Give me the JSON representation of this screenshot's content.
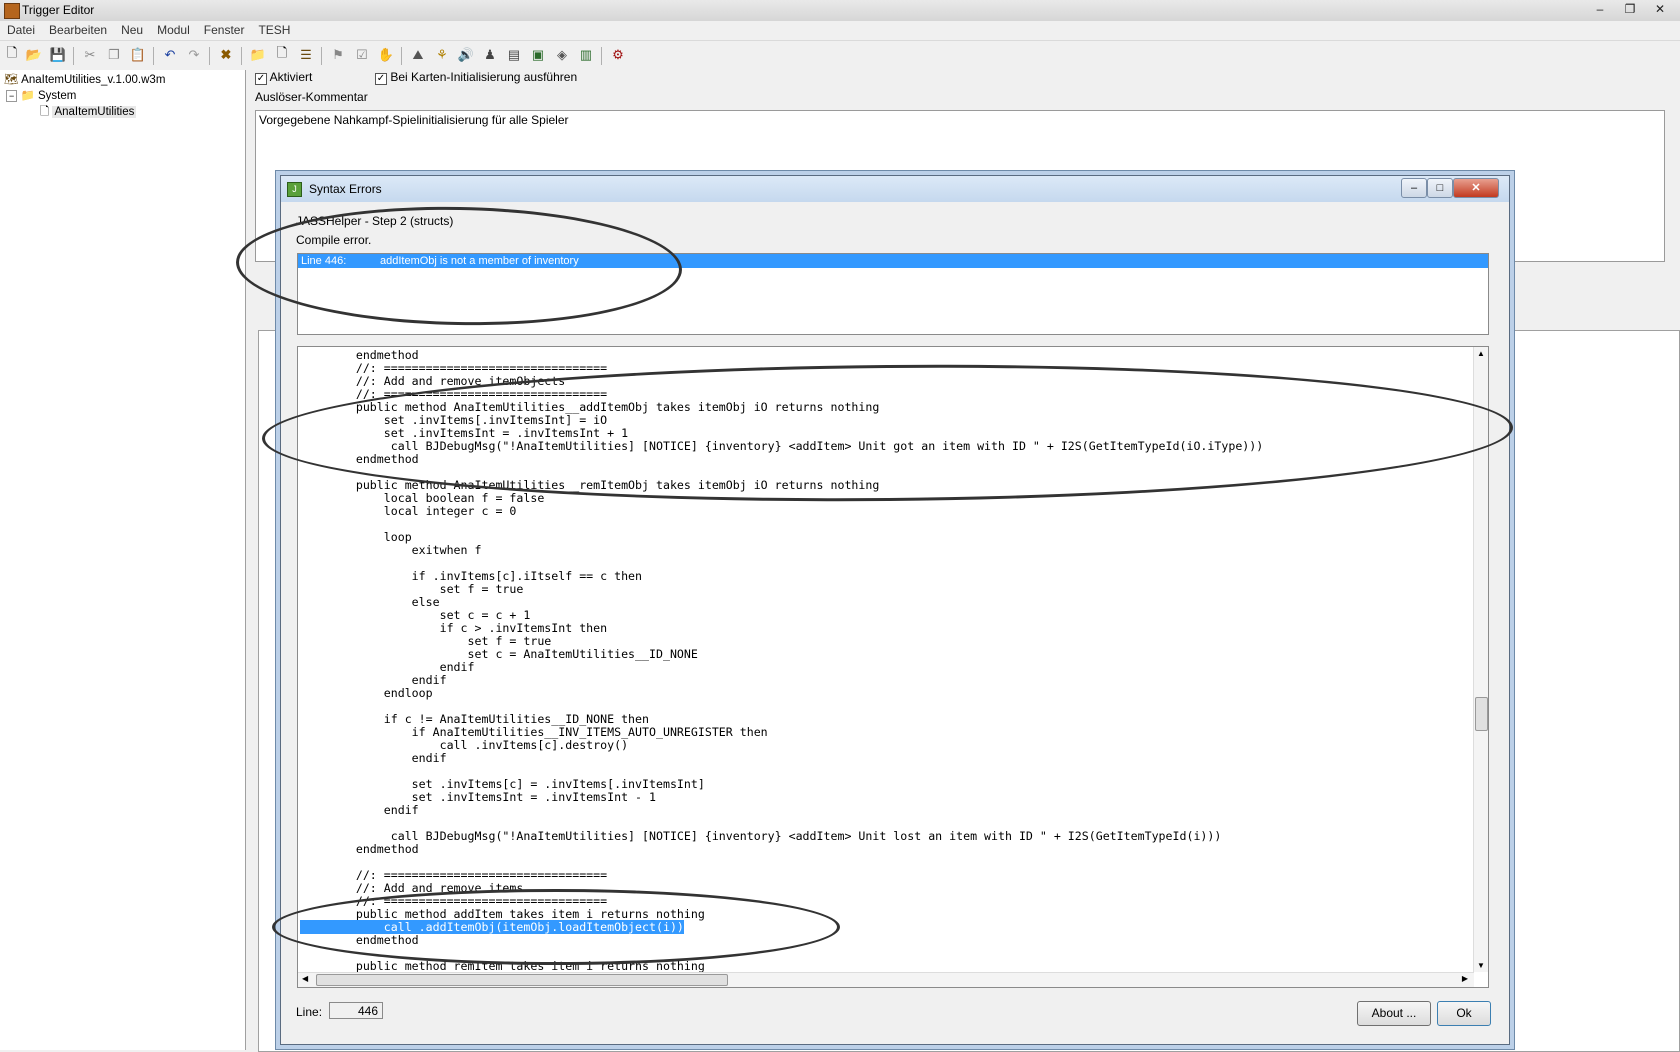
{
  "window": {
    "title": "Trigger Editor"
  },
  "menu": [
    "Datei",
    "Bearbeiten",
    "Neu",
    "Modul",
    "Fenster",
    "TESH"
  ],
  "tree": {
    "map": "AnaItemUtilities_v.1.00.w3m",
    "folder": "System",
    "trigger": "AnaItemUtilities"
  },
  "trigger_panel": {
    "enabled_label": "Aktiviert",
    "init_label": "Bei Karten-Initialisierung ausführen",
    "comment_label": "Auslöser-Kommentar",
    "comment_text": "Vorgegebene Nahkampf-Spielinitialisierung für alle Spieler"
  },
  "dialog": {
    "title": "Syntax Errors",
    "step": "JASSHelper - Step 2 (structs)",
    "status": "Compile error.",
    "error_line": "Line 446:",
    "error_msg": "addItemObj is not a member of inventory",
    "line_label": "Line:",
    "line_value": "446",
    "about_button": "About ...",
    "ok_button": "Ok",
    "code_before": "        endmethod\n        //: ================================\n        //: Add and remove itemObjects\n        //: ================================\n        public method AnaItemUtilities__addItemObj takes itemObj iO returns nothing\n            set .invItems[.invItemsInt] = iO\n            set .invItemsInt = .invItemsInt + 1\n             call BJDebugMsg(\"!AnaItemUtilities] [NOTICE] {inventory} <addItem> Unit got an item with ID \" + I2S(GetItemTypeId(iO.iType)))\n        endmethod\n\n        public method AnaItemUtilities__remItemObj takes itemObj iO returns nothing\n            local boolean f = false\n            local integer c = 0\n\n            loop\n                exitwhen f\n\n                if .invItems[c].iItself == c then\n                    set f = true\n                else\n                    set c = c + 1\n                    if c > .invItemsInt then\n                        set f = true\n                        set c = AnaItemUtilities__ID_NONE\n                    endif\n                endif\n            endloop\n\n            if c != AnaItemUtilities__ID_NONE then\n                if AnaItemUtilities__INV_ITEMS_AUTO_UNREGISTER then\n                    call .invItems[c].destroy()\n                endif\n\n                set .invItems[c] = .invItems[.invItemsInt]\n                set .invItemsInt = .invItemsInt - 1\n            endif\n\n             call BJDebugMsg(\"!AnaItemUtilities] [NOTICE] {inventory} <addItem> Unit lost an item with ID \" + I2S(GetItemTypeId(i)))\n        endmethod\n\n        //: ================================\n        //: Add and remove items\n        //: ================================\n        public method addItem takes item i returns nothing\n",
    "code_highlight": "            call .addItemObj(itemObj.loadItemObject(i))",
    "code_after": "\n        endmethod\n\n        public method remItem takes item i returns nothing"
  }
}
